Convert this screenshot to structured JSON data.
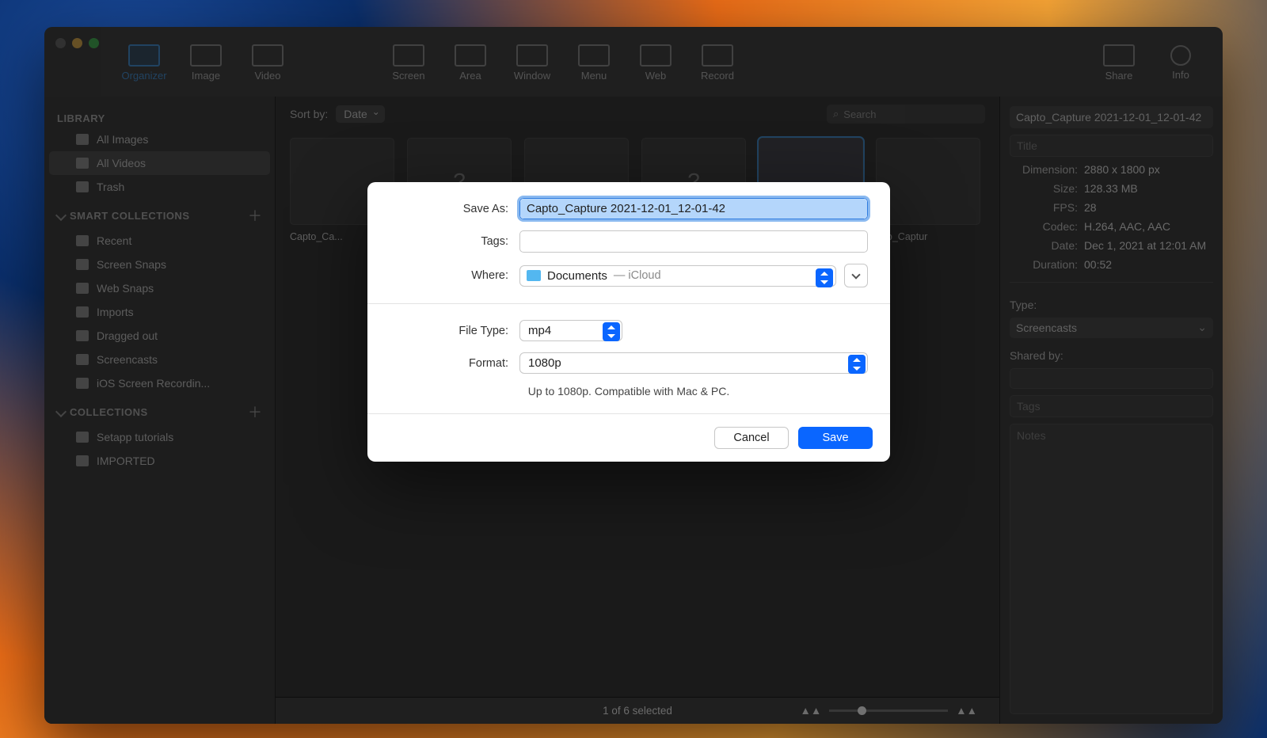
{
  "toolbar": {
    "organizer": "Organizer",
    "image": "Image",
    "video": "Video",
    "screen": "Screen",
    "area": "Area",
    "window": "Window",
    "menu": "Menu",
    "web": "Web",
    "record": "Record",
    "share": "Share",
    "info": "Info"
  },
  "sidebar": {
    "library_header": "LIBRARY",
    "library": [
      {
        "label": "All Images"
      },
      {
        "label": "All Videos"
      },
      {
        "label": "Trash"
      }
    ],
    "smart_header": "SMART COLLECTIONS",
    "smart": [
      {
        "label": "Recent"
      },
      {
        "label": "Screen Snaps"
      },
      {
        "label": "Web Snaps"
      },
      {
        "label": "Imports"
      },
      {
        "label": "Dragged out"
      },
      {
        "label": "Screencasts"
      },
      {
        "label": "iOS Screen Recordin..."
      }
    ],
    "collections_header": "COLLECTIONS",
    "collections": [
      {
        "label": "Setapp tutorials"
      },
      {
        "label": "IMPORTED"
      }
    ]
  },
  "main": {
    "sort_label": "Sort by:",
    "sort_value": "Date",
    "search_placeholder": "Search",
    "thumbs": [
      {
        "label": "Capto_Ca..."
      },
      {
        "label": ""
      },
      {
        "label": ""
      },
      {
        "label": ""
      },
      {
        "label": ""
      },
      {
        "label": "...to_Captur"
      }
    ],
    "footer": "1 of 6 selected"
  },
  "dialog": {
    "save_as_label": "Save As:",
    "save_as_value": "Capto_Capture 2021-12-01_12-01-42",
    "tags_label": "Tags:",
    "where_label": "Where:",
    "where_folder": "Documents",
    "where_cloud": "— iCloud",
    "file_type_label": "File Type:",
    "file_type_value": "mp4",
    "format_label": "Format:",
    "format_value": "1080p",
    "hint": "Up to 1080p. Compatible with Mac & PC.",
    "cancel": "Cancel",
    "save": "Save"
  },
  "inspector": {
    "title": "Capto_Capture 2021-12-01_12-01-42",
    "title_placeholder": "Title",
    "rows": {
      "dimension_k": "Dimension:",
      "dimension_v": "2880 x 1800 px",
      "size_k": "Size:",
      "size_v": "128.33 MB",
      "fps_k": "FPS:",
      "fps_v": "28",
      "codec_k": "Codec:",
      "codec_v": "H.264, AAC, AAC",
      "date_k": "Date:",
      "date_v": "Dec 1, 2021 at 12:01 AM",
      "duration_k": "Duration:",
      "duration_v": "00:52"
    },
    "type_label": "Type:",
    "type_value": "Screencasts",
    "shared_label": "Shared by:",
    "tags_label": "Tags",
    "notes_label": "Notes"
  }
}
